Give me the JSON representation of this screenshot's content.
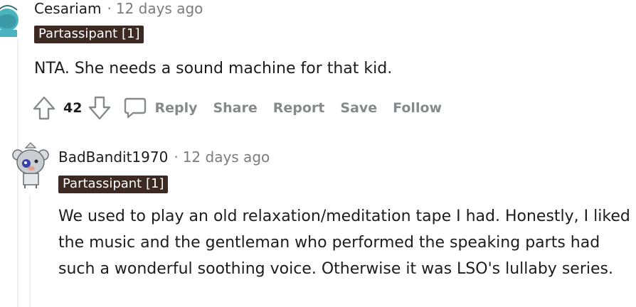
{
  "comments": [
    {
      "author": "Cesariam",
      "separator": "·",
      "time": "12 days ago",
      "flair": "Partassipant [1]",
      "body": "NTA. She needs a sound machine for that kid.",
      "votes": "42",
      "actions": {
        "reply": "Reply",
        "share": "Share",
        "report": "Report",
        "save": "Save",
        "follow": "Follow"
      },
      "colors": {
        "avatar_bg": "#4bb2c0"
      }
    },
    {
      "author": "BadBandit1970",
      "separator": "·",
      "time": "12 days ago",
      "flair": "Partassipant [1]",
      "body": "We used to play an old relaxation/meditation tape I had. Honestly, I liked the music and the gentleman who performed the speaking parts had such a wonderful soothing voice. Otherwise it was LSO's lullaby series."
    }
  ],
  "colors": {
    "flair_bg": "#3c2a22",
    "meta_gray": "#7c7c7c",
    "action_gray": "#878a8c",
    "thread_line": "#edeff1"
  },
  "icons": {
    "upvote": "arrow-up-icon",
    "downvote": "arrow-down-icon",
    "reply": "speech-bubble-icon"
  }
}
